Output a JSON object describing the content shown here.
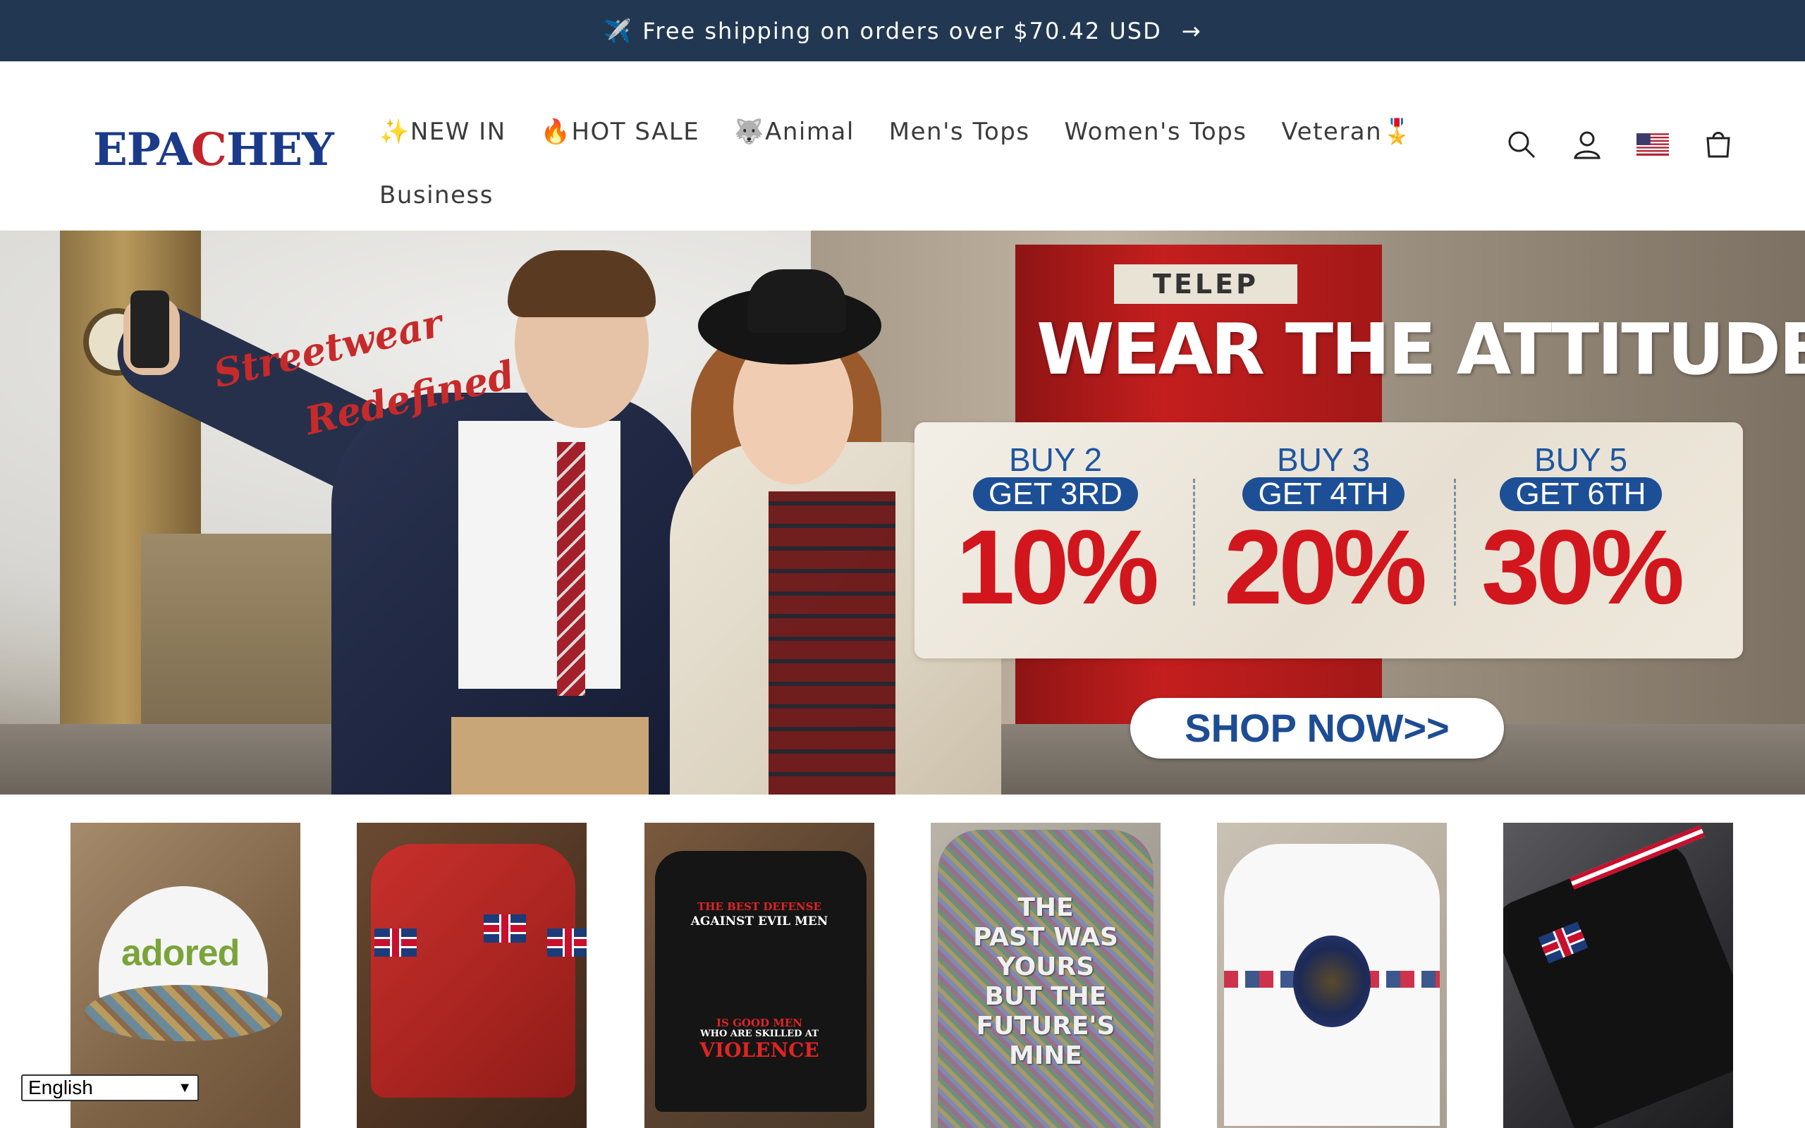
{
  "announcement": {
    "icon": "airplane-icon",
    "emoji": "✈️",
    "text": "Free shipping on orders over $70.42 USD",
    "arrow": "→",
    "background": "#223852"
  },
  "header": {
    "logo": {
      "part1": "EPA",
      "part2": "C",
      "part3": "HEY"
    },
    "nav_row1": [
      "✨NEW IN",
      "🔥HOT SALE",
      "🐺Animal",
      "Men's Tops",
      "Women's Tops",
      "Veteran🎖️"
    ],
    "nav_row2": [
      "Business"
    ],
    "icons": [
      "search-icon",
      "account-icon",
      "us-flag-icon",
      "cart-icon"
    ]
  },
  "hero": {
    "script_line1": "Streetwear",
    "script_line2": "Redefined",
    "phonebox_sign": "TELEP",
    "headline": "WEAR THE ATTITUDE",
    "offers": [
      {
        "buy": "BUY 2",
        "get": "GET 3RD",
        "pct": "10%"
      },
      {
        "buy": "BUY 3",
        "get": "GET 4TH",
        "pct": "20%"
      },
      {
        "buy": "BUY 5",
        "get": "GET 6TH",
        "pct": "30%"
      }
    ],
    "cta": "SHOP NOW>>",
    "colors": {
      "offer_blue": "#1d4f96",
      "pct_red": "#d1161d"
    }
  },
  "products": [
    {
      "cap_text": "adored"
    },
    {},
    {
      "line1": "THE BEST DEFENSE",
      "line2": "AGAINST EVIL MEN",
      "line3": "IS GOOD MEN",
      "line4": "WHO ARE SKILLED AT",
      "line5": "VIOLENCE"
    },
    {
      "lines": [
        "THE",
        "PAST WAS",
        "YOURS",
        "BUT THE",
        "FUTURE'S",
        "MINE"
      ]
    },
    {},
    {}
  ],
  "language": {
    "selected": "English"
  }
}
